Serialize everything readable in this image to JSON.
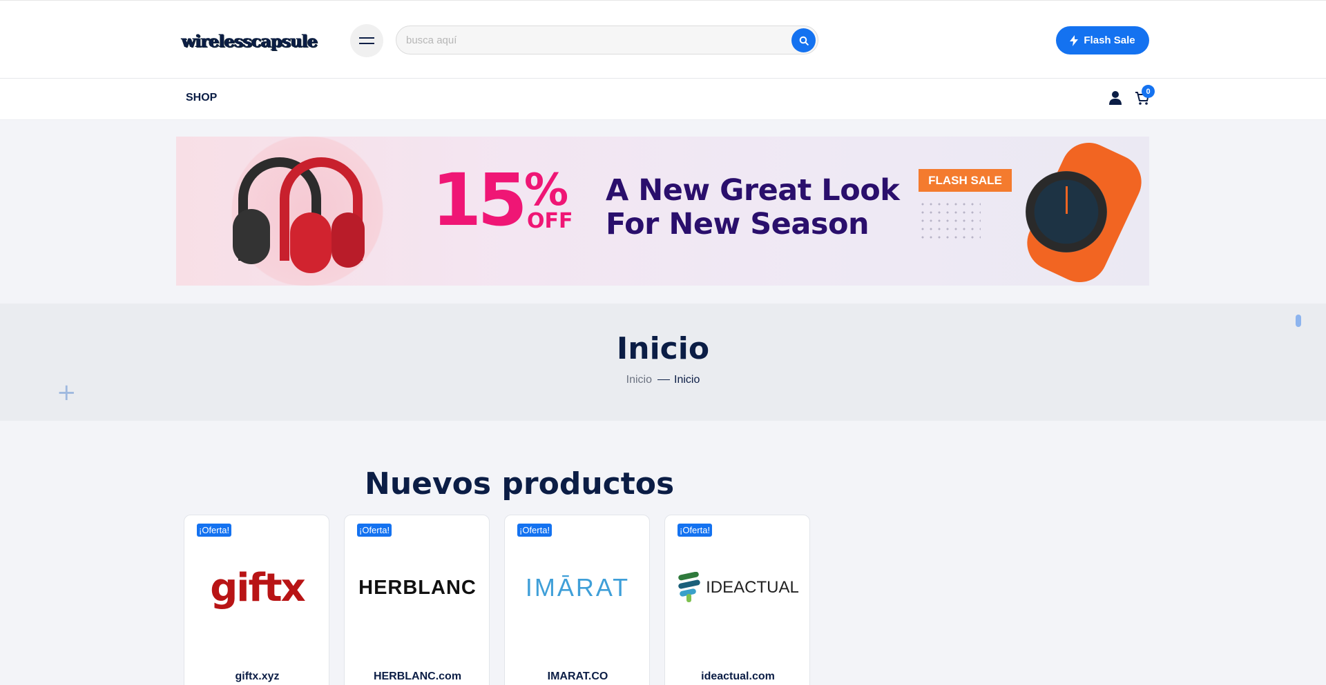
{
  "header": {
    "logo_text": "wirelesscapsule",
    "search_placeholder": "busca aquí",
    "flash_sale_label": "Flash Sale"
  },
  "nav": {
    "shop_label": "SHOP",
    "cart_count": "0"
  },
  "banner": {
    "discount_number": "15",
    "discount_percent": "%",
    "discount_off": "OFF",
    "headline_line1": "A New Great Look",
    "headline_line2": "For New Season",
    "tag": "FLASH SALE"
  },
  "page": {
    "title": "Inicio",
    "breadcrumb": [
      "Inicio",
      "Inicio"
    ]
  },
  "products_section": {
    "title": "Nuevos productos",
    "items": [
      {
        "badge": "¡Oferta!",
        "logo_text": "giftx",
        "name": "giftx.xyz"
      },
      {
        "badge": "¡Oferta!",
        "logo_text": "HERBLANC",
        "name": "HERBLANC.com"
      },
      {
        "badge": "¡Oferta!",
        "logo_text": "IMĀRAT",
        "name": "IMARAT.CO"
      },
      {
        "badge": "¡Oferta!",
        "logo_text": "IDEACTUAL",
        "name": "ideactual.com"
      }
    ]
  },
  "colors": {
    "primary": "#1472f0",
    "navy": "#0b1d45",
    "accent_pink": "#ef1675",
    "accent_orange": "#f47b2e"
  }
}
